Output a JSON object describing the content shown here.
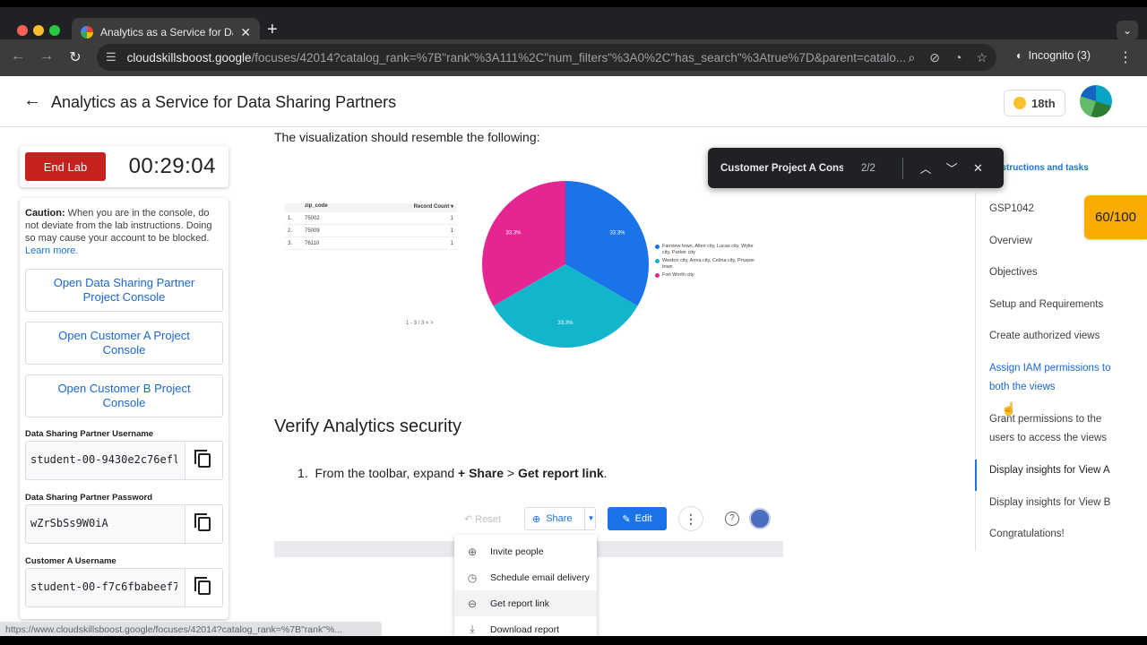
{
  "browser": {
    "tab_title": "Analytics as a Service for Dat",
    "url_host": "cloudskillsboost.google",
    "url_path": "/focuses/42014?catalog_rank=%7B\"rank\"%3A111%2C\"num_filters\"%3A0%2C\"has_search\"%3Atrue%7D&parent=catalo...",
    "profile_label": "Incognito (3)",
    "status_url": "https://www.cloudskillsboost.google/focuses/42014?catalog_rank=%7B\"rank\"%..."
  },
  "find": {
    "query": "Customer Project A Console",
    "count": "2/2"
  },
  "header": {
    "title": "Analytics as a Service for Data Sharing Partners",
    "points": "18th"
  },
  "lab": {
    "end_label": "End Lab",
    "timer": "00:29:04",
    "caution_bold": "Caution:",
    "caution_text": " When you are in the console, do not deviate from the lab instructions. Doing so may cause your account to be blocked.",
    "learn_more": "Learn more.",
    "buttons": [
      "Open Data Sharing Partner Project Console",
      "Open Customer A Project Console",
      "Open Customer B Project Console"
    ],
    "fields": [
      {
        "label": "Data Sharing Partner Username",
        "value": "student-00-9430e2c76efl"
      },
      {
        "label": "Data Sharing Partner Password",
        "value": "wZrSbSs9W0iA"
      },
      {
        "label": "Customer A Username",
        "value": "student-00-f7c6fbabeef7"
      }
    ]
  },
  "content": {
    "intro": "The visualization should resemble the following:",
    "heading": "Verify Analytics security",
    "step_number": "1.",
    "step_prefix": "From the toolbar, expand ",
    "step_share": "+ Share",
    "step_gt": " > ",
    "step_link": "Get report link",
    "step_end": "."
  },
  "viz_table": {
    "headers": [
      "",
      "zip_code",
      "Record Count ▾"
    ],
    "rows": [
      [
        "1.",
        "75002",
        "1"
      ],
      [
        "2.",
        "75009",
        "1"
      ],
      [
        "3.",
        "76110",
        "1"
      ]
    ],
    "pager": "1 - 3 / 3   <   >"
  },
  "chart_data": {
    "type": "pie",
    "title": "",
    "slices": [
      {
        "label": "Fairview town, Allen city, Lucas city, Wylie city, Parker city",
        "value": 33.3,
        "color": "#1a73e8"
      },
      {
        "label": "Weston city, Anna city, Celina city, Prosper town",
        "value": 33.3,
        "color": "#12b5cb"
      },
      {
        "label": "Fort Worth city",
        "value": 33.3,
        "color": "#e52592"
      }
    ],
    "data_labels": [
      "33.3%",
      "33.3%",
      "33.3%"
    ],
    "legend_position": "right"
  },
  "report_toolbar": {
    "reset": "Reset",
    "share": "Share",
    "edit": "Edit"
  },
  "share_menu": [
    {
      "label": "Invite people",
      "icon": "person-add-icon"
    },
    {
      "label": "Schedule email delivery",
      "icon": "clock-icon"
    },
    {
      "label": "Get report link",
      "icon": "link-icon"
    },
    {
      "label": "Download report",
      "icon": "download-icon"
    }
  ],
  "right_nav": {
    "title": "Lab instructions and tasks",
    "score": "60/100",
    "items": [
      "GSP1042",
      "Overview",
      "Objectives",
      "Setup and Requirements",
      "Create authorized views",
      "Assign IAM permissions to both the views",
      "Grant permissions to the users to access the views",
      "Display insights for View A",
      "Display insights for View B",
      "Congratulations!"
    ]
  }
}
